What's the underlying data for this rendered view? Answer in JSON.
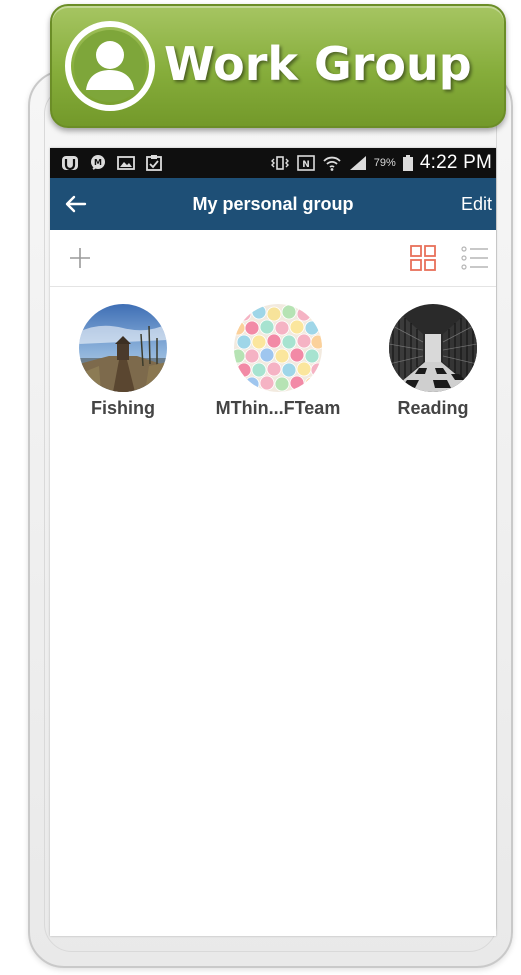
{
  "banner": {
    "title": "Work Group",
    "icon": "user-circle-icon"
  },
  "status_bar": {
    "left_icons": [
      "app-notification-icon",
      "messenger-icon",
      "gallery-icon",
      "clipboard-icon"
    ],
    "right_icons": [
      "vibrate-icon",
      "nfc-icon",
      "wifi-icon",
      "signal-icon",
      "battery-icon"
    ],
    "battery_percent": "79%",
    "time": "4:22 PM"
  },
  "app_bar": {
    "title": "My personal group",
    "edit_label": "Edit",
    "background": "#1e4f76"
  },
  "toolbar": {
    "add_icon": "plus-icon",
    "grid_view_icon": "grid-view-icon",
    "list_view_icon": "list-view-icon",
    "active_view": "grid",
    "active_color": "#e8705a"
  },
  "groups": [
    {
      "name": "Fishing",
      "avatar": "pier-landscape"
    },
    {
      "name": "MThin...FTeam",
      "avatar": "colorful-chalk"
    },
    {
      "name": "Reading",
      "avatar": "library-shelves"
    }
  ],
  "colors": {
    "banner_green": "#86ad3b",
    "status_bar": "#0f0f0f",
    "group_label": "#444444"
  }
}
